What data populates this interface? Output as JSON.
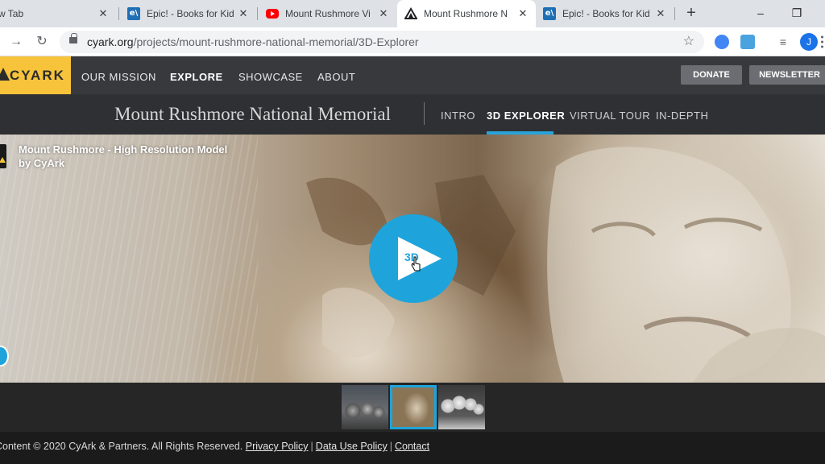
{
  "browser": {
    "tabs": [
      {
        "title": "w Tab",
        "favicon": "new-tab-icon",
        "active": false
      },
      {
        "title": "Epic! - Books for Kid",
        "favicon": "epic-icon",
        "active": false
      },
      {
        "title": "Mount Rushmore Vi",
        "favicon": "youtube-icon",
        "active": false
      },
      {
        "title": "Mount Rushmore N",
        "favicon": "cyark-icon",
        "active": true
      },
      {
        "title": "Epic! - Books for Kid",
        "favicon": "epic-icon",
        "active": false
      }
    ],
    "new_tab": "+",
    "window_controls": {
      "minimize": "–",
      "maximize": "❐"
    },
    "url": {
      "domain": "cyark.org",
      "path": "/projects/mount-rushmore-national-memorial/3D-Explorer"
    },
    "profile_initial": "J",
    "favicon_letter": "e\\"
  },
  "site": {
    "logo_text": "CYARK",
    "nav": [
      "OUR MISSION",
      "EXPLORE",
      "SHOWCASE",
      "ABOUT"
    ],
    "active_nav": "EXPLORE",
    "buttons": {
      "donate": "DONATE",
      "newsletter": "NEWSLETTER"
    }
  },
  "project": {
    "title": "Mount Rushmore National Memorial",
    "subnav": [
      "INTRO",
      "3D EXPLORER",
      "VIRTUAL TOUR",
      "IN-DEPTH"
    ],
    "active_subnav": "3D EXPLORER"
  },
  "viewer": {
    "model_title": "Mount Rushmore - High Resolution Model",
    "model_author": "by CyArk",
    "play_label": "3D",
    "accent": "#1ea4db"
  },
  "thumbnails": {
    "count": 3,
    "selected_index": 1
  },
  "footer": {
    "copyright": "Content © 2020 CyArk & Partners. All Rights Reserved.",
    "links": [
      "Privacy Policy",
      "Data Use Policy",
      "Contact"
    ],
    "separator": "|"
  },
  "colors": {
    "brand_yellow": "#f6c33b",
    "header_bg": "#37393d",
    "subheader_bg": "#2e3033"
  }
}
